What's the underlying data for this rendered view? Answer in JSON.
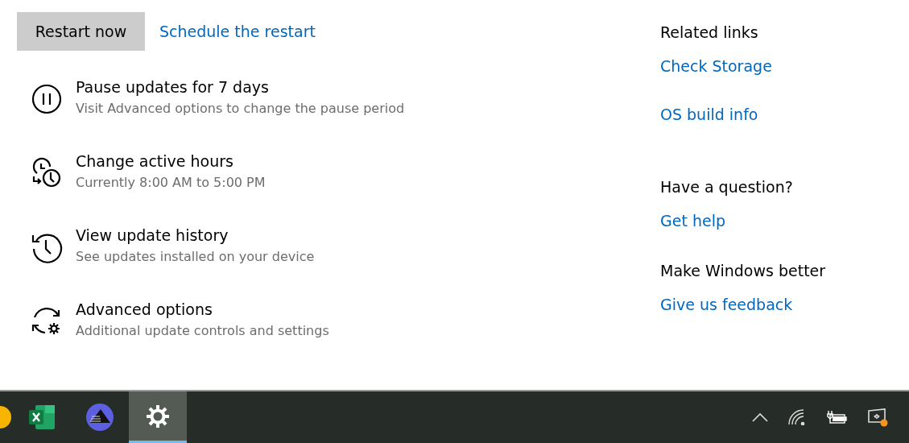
{
  "actions": {
    "restart_button": "Restart now",
    "schedule_link": "Schedule the restart"
  },
  "options": [
    {
      "kind": "pause",
      "title": "Pause updates for 7 days",
      "subtitle": "Visit Advanced options to change the pause period"
    },
    {
      "kind": "hours",
      "title": "Change active hours",
      "subtitle": "Currently 8:00 AM to 5:00 PM"
    },
    {
      "kind": "history",
      "title": "View update history",
      "subtitle": "See updates installed on your device"
    },
    {
      "kind": "advanced",
      "title": "Advanced options",
      "subtitle": "Additional update controls and settings"
    }
  ],
  "sidebar": [
    {
      "heading": "Related links",
      "links": [
        "Check Storage",
        "OS build info"
      ]
    },
    {
      "heading": "Have a question?",
      "links": [
        "Get help"
      ]
    },
    {
      "heading": "Make Windows better",
      "links": [
        "Give us feedback"
      ]
    }
  ],
  "taskbar": {
    "apps": [
      {
        "kind": "yellow",
        "selected": false
      },
      {
        "kind": "sheet",
        "selected": false
      },
      {
        "kind": "pyramid",
        "selected": false
      },
      {
        "kind": "gear",
        "selected": true
      }
    ],
    "tray": [
      {
        "kind": "caret"
      },
      {
        "kind": "wifi"
      },
      {
        "kind": "battery"
      },
      {
        "kind": "screen"
      }
    ]
  }
}
